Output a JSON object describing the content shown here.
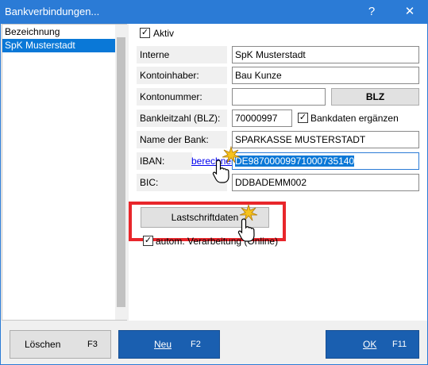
{
  "window": {
    "title": "Bankverbindungen..."
  },
  "titlebar": {
    "help_glyph": "?",
    "close_glyph": "✕"
  },
  "list": {
    "header": "Bezeichnung",
    "items": [
      {
        "label": "SpK Musterstadt",
        "selected": true
      }
    ]
  },
  "form": {
    "aktiv_label": "Aktiv",
    "aktiv_checked": true,
    "interne_bezeichnung_label": "Interne Bezeichnung:",
    "interne_bezeichnung_value": "SpK Musterstadt",
    "kontoinhaber_label": "Kontoinhaber:",
    "kontoinhaber_value": "Bau Kunze",
    "kontonummer_label": "Kontonummer:",
    "kontonummer_value": "",
    "blz_button_label": "BLZ",
    "bankleitzahl_label": "Bankleitzahl (BLZ):",
    "bankleitzahl_value": "70000997",
    "bankdaten_label": "Bankdaten ergänzen",
    "bankdaten_checked": true,
    "name_der_bank_label": "Name der Bank:",
    "name_der_bank_value": "SPARKASSE MUSTERSTADT",
    "iban_label": "IBAN:",
    "iban_link": "berechnen",
    "iban_value": "DE98700009971000735140",
    "bic_label": "BIC:",
    "bic_value": "DDBADEMM002",
    "lastschrift_button_label": "Lastschriftdaten",
    "autom_label": "autom. Verarbeitung (Online)",
    "autom_checked": true
  },
  "bottom": {
    "loeschen_label": "Löschen",
    "loeschen_key": "F3",
    "neu_label": "Neu",
    "neu_key": "F2",
    "ok_label": "OK",
    "ok_key": "F11"
  },
  "colors": {
    "accent": "#2b7bd6",
    "selection": "#0a78d7",
    "highlight": "#e8262b"
  },
  "icons": {
    "pointer": "hand-pointer-icon",
    "click_burst": "click-burst-icon"
  }
}
